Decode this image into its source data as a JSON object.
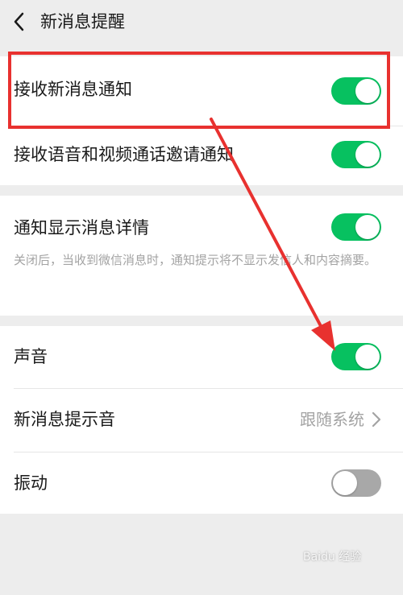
{
  "header": {
    "back_icon": "chevron-left-icon",
    "title": "新消息提醒"
  },
  "settings": {
    "receive_new_message_notification": {
      "label": "接收新消息通知",
      "enabled": true
    },
    "receive_voice_video_invite_notification": {
      "label": "接收语音和视频通话邀请通知",
      "enabled": true
    },
    "show_message_details": {
      "label": "通知显示消息详情",
      "enabled": true,
      "description": "关闭后，当收到微信消息时，通知提示将不显示发信人和内容摘要。"
    },
    "sound": {
      "label": "声音",
      "enabled": true
    },
    "new_message_tone": {
      "label": "新消息提示音",
      "value": "跟随系统"
    },
    "vibrate": {
      "label": "振动",
      "enabled": false
    }
  },
  "colors": {
    "toggle_on": "#07c160",
    "toggle_off": "#a8a8a8",
    "annotation_red": "#e8312f",
    "page_background": "#ededed"
  },
  "watermark": {
    "text": "Baidu 经验"
  }
}
